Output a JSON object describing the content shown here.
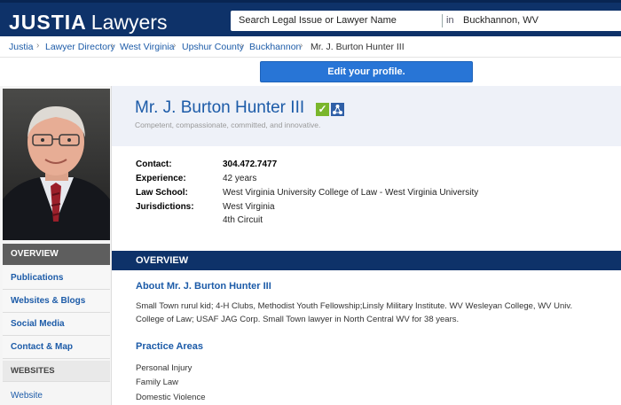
{
  "header": {
    "logo_brand": "JUSTIA",
    "logo_sub": "Lawyers",
    "search_placeholder": "Search Legal Issue or Lawyer Name",
    "search_in": "in",
    "search_location": "Buckhannon, WV"
  },
  "breadcrumb": [
    "Justia",
    "Lawyer Directory",
    "West Virginia",
    "Upshur County",
    "Buckhannon",
    "Mr. J. Burton Hunter III"
  ],
  "edit_button": "Edit your profile.",
  "sidebar": {
    "overview": "OVERVIEW",
    "links": [
      "Publications",
      "Websites & Blogs",
      "Social Media",
      "Contact & Map"
    ],
    "websites_heading": "WEBSITES",
    "website_link": "Website"
  },
  "profile": {
    "name": "Mr. J. Burton Hunter III",
    "tagline": "Competent, compassionate, committed, and innovative.",
    "details": [
      {
        "label": "Contact:",
        "value": "304.472.7477"
      },
      {
        "label": "Experience:",
        "value": "42 years"
      },
      {
        "label": "Law School:",
        "value": "West Virginia University College of Law - West Virginia University"
      },
      {
        "label": "Jurisdictions:",
        "value": "West Virginia"
      },
      {
        "label": "",
        "value": "4th Circuit"
      }
    ]
  },
  "overview": {
    "bar_title": "OVERVIEW",
    "about_heading": "About Mr. J. Burton Hunter III",
    "about_text": "Small Town rurul kid; 4-H Clubs, Methodist Youth Fellowship;Linsly Military Institute. WV Wesleyan College, WV Univ. College of Law; USAF JAG Corp. Small Town lawyer in North Central WV for 38 years.",
    "practice_heading": "Practice Areas",
    "practice_areas": [
      "Personal Injury",
      "Family Law",
      "Domestic Violence"
    ]
  },
  "colors": {
    "header_bg": "#0e3269",
    "link": "#1c5ba8",
    "edit_button": "#2875d6",
    "name_panel": "#eef1f8"
  }
}
